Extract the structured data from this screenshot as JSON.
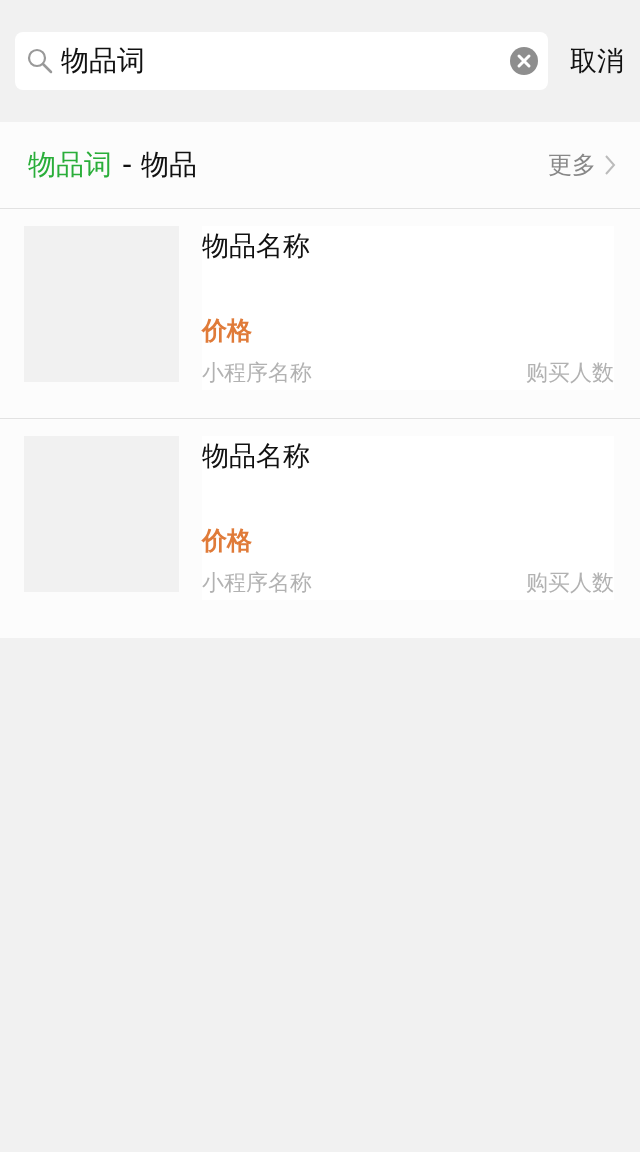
{
  "search": {
    "value": "物品词",
    "cancel": "取消"
  },
  "section": {
    "keyword": "物品词",
    "title": "- 物品",
    "more": "更多"
  },
  "items": [
    {
      "name": "物品名称",
      "price": "价格",
      "app": "小程序名称",
      "buyers": "购买人数"
    },
    {
      "name": "物品名称",
      "price": "价格",
      "app": "小程序名称",
      "buyers": "购买人数"
    }
  ]
}
